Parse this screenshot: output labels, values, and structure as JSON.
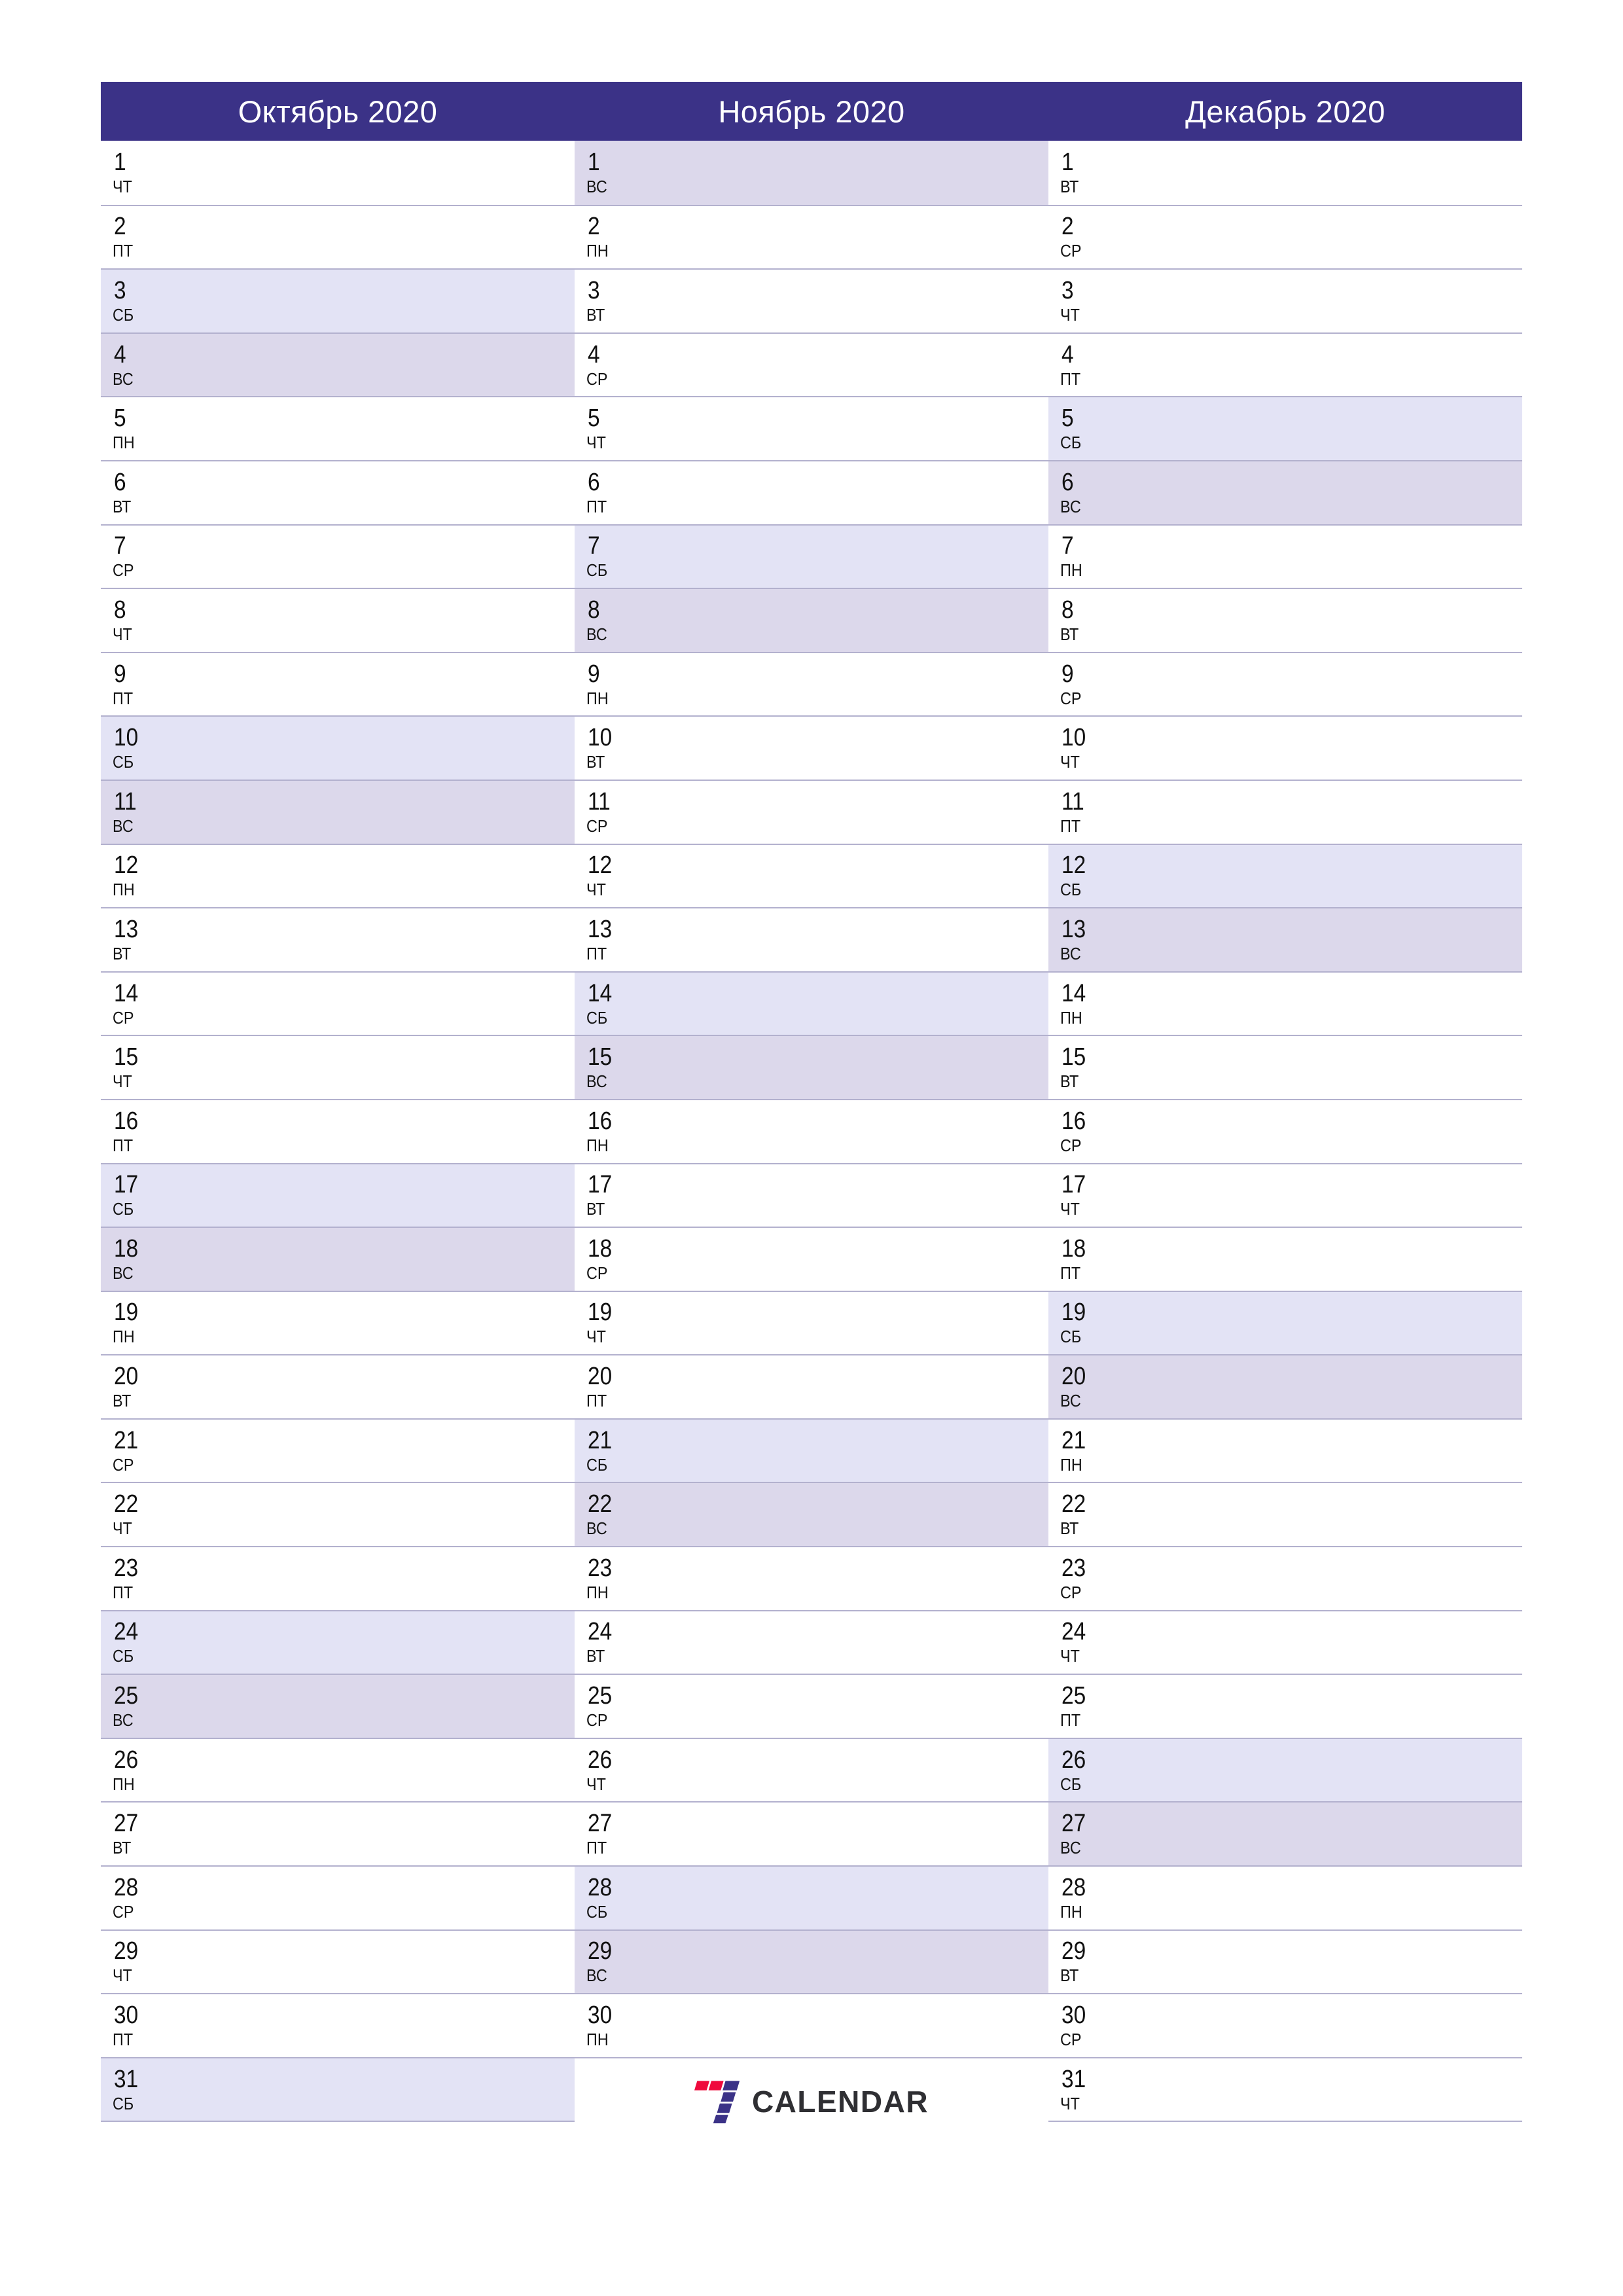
{
  "page": {
    "title": "Календарь Октябрь — Декабрь 2020",
    "background": "#FFFFFF",
    "header_color": "#3B3287",
    "saturday_color": "#E3E3F5",
    "sunday_color": "#DCD8EB",
    "rule_color": "#B3B1CE",
    "day_text_color": "#111111"
  },
  "weekday_abbr": {
    "mon": "ПН",
    "tue": "ВТ",
    "wed": "СР",
    "thu": "ЧТ",
    "fri": "ПТ",
    "sat": "СБ",
    "sun": "ВС"
  },
  "months": [
    {
      "title": "Октябрь 2020",
      "days": [
        {
          "num": "1",
          "abbr": "ЧТ",
          "kind": "weekday"
        },
        {
          "num": "2",
          "abbr": "ПТ",
          "kind": "weekday"
        },
        {
          "num": "3",
          "abbr": "СБ",
          "kind": "sat"
        },
        {
          "num": "4",
          "abbr": "ВС",
          "kind": "sun"
        },
        {
          "num": "5",
          "abbr": "ПН",
          "kind": "weekday"
        },
        {
          "num": "6",
          "abbr": "ВТ",
          "kind": "weekday"
        },
        {
          "num": "7",
          "abbr": "СР",
          "kind": "weekday"
        },
        {
          "num": "8",
          "abbr": "ЧТ",
          "kind": "weekday"
        },
        {
          "num": "9",
          "abbr": "ПТ",
          "kind": "weekday"
        },
        {
          "num": "10",
          "abbr": "СБ",
          "kind": "sat"
        },
        {
          "num": "11",
          "abbr": "ВС",
          "kind": "sun"
        },
        {
          "num": "12",
          "abbr": "ПН",
          "kind": "weekday"
        },
        {
          "num": "13",
          "abbr": "ВТ",
          "kind": "weekday"
        },
        {
          "num": "14",
          "abbr": "СР",
          "kind": "weekday"
        },
        {
          "num": "15",
          "abbr": "ЧТ",
          "kind": "weekday"
        },
        {
          "num": "16",
          "abbr": "ПТ",
          "kind": "weekday"
        },
        {
          "num": "17",
          "abbr": "СБ",
          "kind": "sat"
        },
        {
          "num": "18",
          "abbr": "ВС",
          "kind": "sun"
        },
        {
          "num": "19",
          "abbr": "ПН",
          "kind": "weekday"
        },
        {
          "num": "20",
          "abbr": "ВТ",
          "kind": "weekday"
        },
        {
          "num": "21",
          "abbr": "СР",
          "kind": "weekday"
        },
        {
          "num": "22",
          "abbr": "ЧТ",
          "kind": "weekday"
        },
        {
          "num": "23",
          "abbr": "ПТ",
          "kind": "weekday"
        },
        {
          "num": "24",
          "abbr": "СБ",
          "kind": "sat"
        },
        {
          "num": "25",
          "abbr": "ВС",
          "kind": "sun"
        },
        {
          "num": "26",
          "abbr": "ПН",
          "kind": "weekday"
        },
        {
          "num": "27",
          "abbr": "ВТ",
          "kind": "weekday"
        },
        {
          "num": "28",
          "abbr": "СР",
          "kind": "weekday"
        },
        {
          "num": "29",
          "abbr": "ЧТ",
          "kind": "weekday"
        },
        {
          "num": "30",
          "abbr": "ПТ",
          "kind": "weekday"
        },
        {
          "num": "31",
          "abbr": "СБ",
          "kind": "sat"
        }
      ],
      "has_logo": false
    },
    {
      "title": "Ноябрь 2020",
      "days": [
        {
          "num": "1",
          "abbr": "ВС",
          "kind": "sun"
        },
        {
          "num": "2",
          "abbr": "ПН",
          "kind": "weekday"
        },
        {
          "num": "3",
          "abbr": "ВТ",
          "kind": "weekday"
        },
        {
          "num": "4",
          "abbr": "СР",
          "kind": "weekday"
        },
        {
          "num": "5",
          "abbr": "ЧТ",
          "kind": "weekday"
        },
        {
          "num": "6",
          "abbr": "ПТ",
          "kind": "weekday"
        },
        {
          "num": "7",
          "abbr": "СБ",
          "kind": "sat"
        },
        {
          "num": "8",
          "abbr": "ВС",
          "kind": "sun"
        },
        {
          "num": "9",
          "abbr": "ПН",
          "kind": "weekday"
        },
        {
          "num": "10",
          "abbr": "ВТ",
          "kind": "weekday"
        },
        {
          "num": "11",
          "abbr": "СР",
          "kind": "weekday"
        },
        {
          "num": "12",
          "abbr": "ЧТ",
          "kind": "weekday"
        },
        {
          "num": "13",
          "abbr": "ПТ",
          "kind": "weekday"
        },
        {
          "num": "14",
          "abbr": "СБ",
          "kind": "sat"
        },
        {
          "num": "15",
          "abbr": "ВС",
          "kind": "sun"
        },
        {
          "num": "16",
          "abbr": "ПН",
          "kind": "weekday"
        },
        {
          "num": "17",
          "abbr": "ВТ",
          "kind": "weekday"
        },
        {
          "num": "18",
          "abbr": "СР",
          "kind": "weekday"
        },
        {
          "num": "19",
          "abbr": "ЧТ",
          "kind": "weekday"
        },
        {
          "num": "20",
          "abbr": "ПТ",
          "kind": "weekday"
        },
        {
          "num": "21",
          "abbr": "СБ",
          "kind": "sat"
        },
        {
          "num": "22",
          "abbr": "ВС",
          "kind": "sun"
        },
        {
          "num": "23",
          "abbr": "ПН",
          "kind": "weekday"
        },
        {
          "num": "24",
          "abbr": "ВТ",
          "kind": "weekday"
        },
        {
          "num": "25",
          "abbr": "СР",
          "kind": "weekday"
        },
        {
          "num": "26",
          "abbr": "ЧТ",
          "kind": "weekday"
        },
        {
          "num": "27",
          "abbr": "ПТ",
          "kind": "weekday"
        },
        {
          "num": "28",
          "abbr": "СБ",
          "kind": "sat"
        },
        {
          "num": "29",
          "abbr": "ВС",
          "kind": "sun"
        },
        {
          "num": "30",
          "abbr": "ПН",
          "kind": "weekday"
        }
      ],
      "has_logo": true
    },
    {
      "title": "Декабрь 2020",
      "days": [
        {
          "num": "1",
          "abbr": "ВТ",
          "kind": "weekday"
        },
        {
          "num": "2",
          "abbr": "СР",
          "kind": "weekday"
        },
        {
          "num": "3",
          "abbr": "ЧТ",
          "kind": "weekday"
        },
        {
          "num": "4",
          "abbr": "ПТ",
          "kind": "weekday"
        },
        {
          "num": "5",
          "abbr": "СБ",
          "kind": "sat"
        },
        {
          "num": "6",
          "abbr": "ВС",
          "kind": "sun"
        },
        {
          "num": "7",
          "abbr": "ПН",
          "kind": "weekday"
        },
        {
          "num": "8",
          "abbr": "ВТ",
          "kind": "weekday"
        },
        {
          "num": "9",
          "abbr": "СР",
          "kind": "weekday"
        },
        {
          "num": "10",
          "abbr": "ЧТ",
          "kind": "weekday"
        },
        {
          "num": "11",
          "abbr": "ПТ",
          "kind": "weekday"
        },
        {
          "num": "12",
          "abbr": "СБ",
          "kind": "sat"
        },
        {
          "num": "13",
          "abbr": "ВС",
          "kind": "sun"
        },
        {
          "num": "14",
          "abbr": "ПН",
          "kind": "weekday"
        },
        {
          "num": "15",
          "abbr": "ВТ",
          "kind": "weekday"
        },
        {
          "num": "16",
          "abbr": "СР",
          "kind": "weekday"
        },
        {
          "num": "17",
          "abbr": "ЧТ",
          "kind": "weekday"
        },
        {
          "num": "18",
          "abbr": "ПТ",
          "kind": "weekday"
        },
        {
          "num": "19",
          "abbr": "СБ",
          "kind": "sat"
        },
        {
          "num": "20",
          "abbr": "ВС",
          "kind": "sun"
        },
        {
          "num": "21",
          "abbr": "ПН",
          "kind": "weekday"
        },
        {
          "num": "22",
          "abbr": "ВТ",
          "kind": "weekday"
        },
        {
          "num": "23",
          "abbr": "СР",
          "kind": "weekday"
        },
        {
          "num": "24",
          "abbr": "ЧТ",
          "kind": "weekday"
        },
        {
          "num": "25",
          "abbr": "ПТ",
          "kind": "weekday"
        },
        {
          "num": "26",
          "abbr": "СБ",
          "kind": "sat"
        },
        {
          "num": "27",
          "abbr": "ВС",
          "kind": "sun"
        },
        {
          "num": "28",
          "abbr": "ПН",
          "kind": "weekday"
        },
        {
          "num": "29",
          "abbr": "ВТ",
          "kind": "weekday"
        },
        {
          "num": "30",
          "abbr": "СР",
          "kind": "weekday"
        },
        {
          "num": "31",
          "abbr": "ЧТ",
          "kind": "weekday"
        }
      ],
      "has_logo": false
    }
  ],
  "logo": {
    "text": "CALENDAR",
    "mark_name": "seven-logo-mark",
    "accent_red": "#EF0A3C",
    "accent_indigo": "#3B3287",
    "text_color": "#2F2F33"
  }
}
